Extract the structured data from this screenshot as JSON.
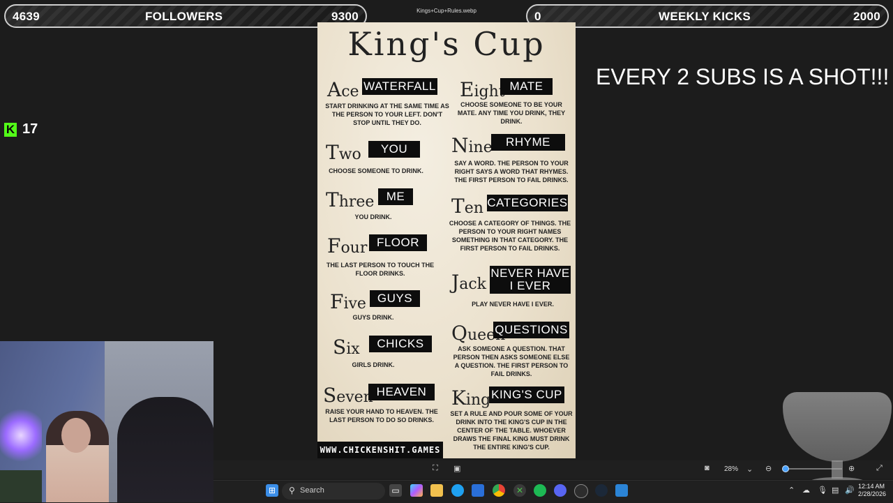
{
  "counters": {
    "followers": {
      "current": "4639",
      "label": "FOLLOWERS",
      "goal": "9300"
    },
    "kicks": {
      "current": "0",
      "label": "WEEKLY KICKS",
      "goal": "2000"
    }
  },
  "viewer": {
    "file_title": "Kings+Cup+Rules.webp",
    "zoom_level": "28%"
  },
  "poster": {
    "title": "King's Cup",
    "website": "WWW.CHICKENSHIT.GAMES",
    "cards": [
      {
        "name": "Ace",
        "rule": "WATERFALL",
        "desc": "START DRINKING AT THE SAME TIME AS THE PERSON TO YOUR LEFT. DON'T STOP UNTIL THEY DO."
      },
      {
        "name": "Two",
        "rule": "YOU",
        "desc": "CHOOSE SOMEONE TO DRINK."
      },
      {
        "name": "Three",
        "rule": "ME",
        "desc": "YOU DRINK."
      },
      {
        "name": "Four",
        "rule": "FLOOR",
        "desc": "THE LAST PERSON TO TOUCH THE FLOOR DRINKS."
      },
      {
        "name": "Five",
        "rule": "GUYS",
        "desc": "GUYS DRINK."
      },
      {
        "name": "Six",
        "rule": "CHICKS",
        "desc": "GIRLS DRINK."
      },
      {
        "name": "Seven",
        "rule": "HEAVEN",
        "desc": "RAISE YOUR HAND TO HEAVEN. THE LAST PERSON TO DO SO DRINKS."
      },
      {
        "name": "Eight",
        "rule": "MATE",
        "desc": "CHOOSE SOMEONE TO BE YOUR MATE. ANY TIME YOU DRINK, THEY DRINK."
      },
      {
        "name": "Nine",
        "rule": "RHYME",
        "desc": "SAY A WORD. THE PERSON TO YOUR RIGHT SAYS A WORD THAT RHYMES. THE FIRST PERSON TO FAIL DRINKS."
      },
      {
        "name": "Ten",
        "rule": "CATEGORIES",
        "desc": "CHOOSE A CATEGORY OF THINGS. THE PERSON TO YOUR RIGHT NAMES SOMETHING IN THAT CATEGORY. THE FIRST PERSON TO FAIL DRINKS."
      },
      {
        "name": "Jack",
        "rule": "NEVER HAVE I EVER",
        "desc": "PLAY NEVER HAVE I EVER."
      },
      {
        "name": "Queen",
        "rule": "QUESTIONS",
        "desc": "ASK SOMEONE A QUESTION. THAT PERSON THEN ASKS SOMEONE ELSE A QUESTION. THE FIRST PERSON TO FAIL DRINKS."
      },
      {
        "name": "King",
        "rule": "KING'S CUP",
        "desc": "SET A RULE AND POUR SOME OF YOUR DRINK INTO THE KING'S CUP IN THE CENTER OF THE TABLE.  WHOEVER DRAWS THE FINAL KING MUST DRINK THE ENTIRE KING'S CUP."
      }
    ]
  },
  "overlay_text": "EVERY 2 SUBS IS A SHOT!!!",
  "kick_badge": {
    "icon": "kick-logo-icon",
    "count": "17"
  },
  "taskbar": {
    "search_placeholder": "Search",
    "time": "12:14 AM",
    "date": "2/28/2026",
    "icons": [
      "windows-start-icon",
      "file-explorer-icon",
      "copilot-icon",
      "folder-icon",
      "edge-icon",
      "store-icon",
      "chrome-icon",
      "xbox-icon",
      "spotify-icon",
      "discord-icon",
      "obs-icon",
      "steam-icon",
      "app-icon"
    ]
  },
  "colors": {
    "kick_green": "#53fc18",
    "accent_blue": "#4aa3ff"
  }
}
